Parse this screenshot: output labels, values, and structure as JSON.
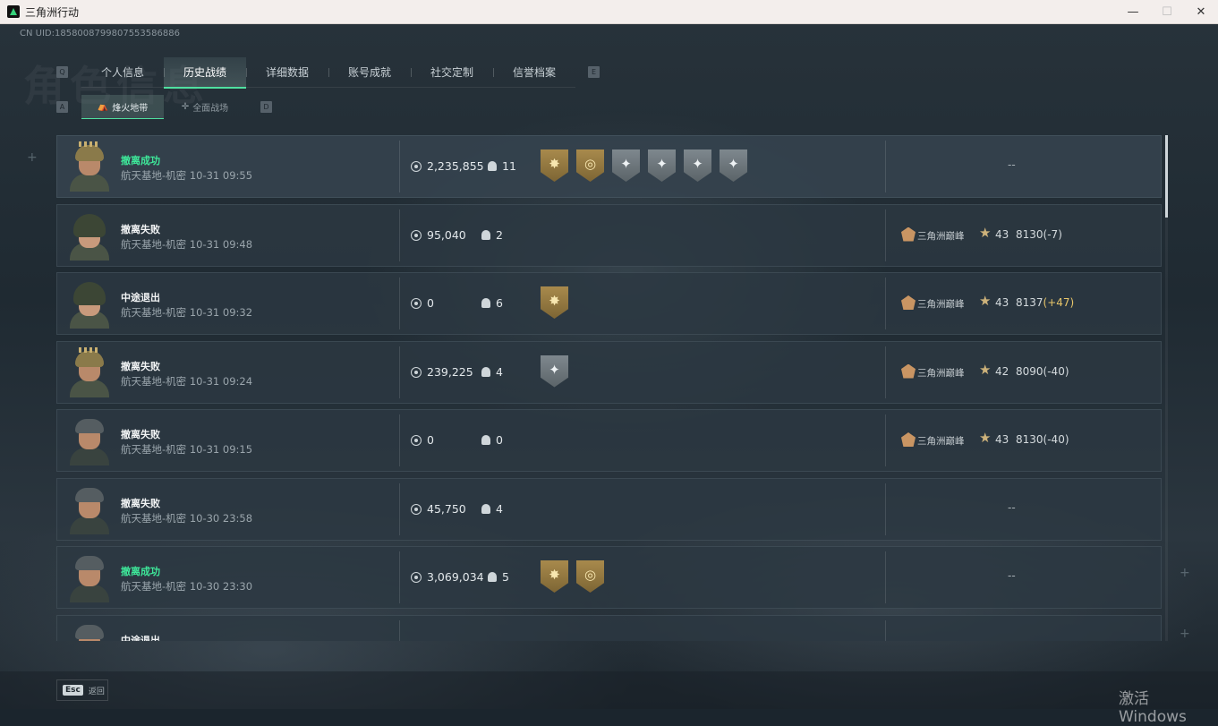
{
  "window": {
    "title": "三角洲行动",
    "controls": [
      "—",
      "☐",
      "✕"
    ]
  },
  "header": {
    "uid": "CN UID:1858008799807553586886",
    "watermark": "角色信息"
  },
  "tabs": {
    "left_key": "Q",
    "right_key": "E",
    "items": [
      "个人信息",
      "历史战绩",
      "详细数据",
      "账号成就",
      "社交定制",
      "信誉档案"
    ],
    "active_index": 1
  },
  "subtabs": {
    "left_key": "A",
    "right_key": "D",
    "items": [
      {
        "icon": "beacon-icon",
        "label": "烽火地带"
      },
      {
        "icon": "crosshair-icon",
        "label": "全面战场"
      }
    ]
  },
  "records": [
    {
      "status": "撤离成功",
      "success": true,
      "map": "航天基地-机密",
      "time": "10-31 09:55",
      "value": "2,235,855",
      "kills": "11",
      "badges": [
        "gold",
        "gold",
        "silver",
        "silver",
        "silver",
        "silver"
      ],
      "rank": null,
      "avatar": "crown"
    },
    {
      "status": "撤离失败",
      "success": false,
      "map": "航天基地-机密",
      "time": "10-31 09:48",
      "value": "95,040",
      "kills": "2",
      "badges": [],
      "rank": {
        "name": "三角洲巅峰",
        "level": "43",
        "points": "8130",
        "delta": "(-7)",
        "delta_positive": false
      },
      "avatar": "hood"
    },
    {
      "status": "中途退出",
      "success": false,
      "map": "航天基地-机密",
      "time": "10-31 09:32",
      "value": "0",
      "kills": "6",
      "badges": [
        "gold"
      ],
      "rank": {
        "name": "三角洲巅峰",
        "level": "43",
        "points": "8137",
        "delta": "(+47)",
        "delta_positive": true
      },
      "avatar": "hood"
    },
    {
      "status": "撤离失败",
      "success": false,
      "map": "航天基地-机密",
      "time": "10-31 09:24",
      "value": "239,225",
      "kills": "4",
      "badges": [
        "silver"
      ],
      "rank": {
        "name": "三角洲巅峰",
        "level": "42",
        "points": "8090",
        "delta": "(-40)",
        "delta_positive": false
      },
      "avatar": "crown"
    },
    {
      "status": "撤离失败",
      "success": false,
      "map": "航天基地-机密",
      "time": "10-31 09:15",
      "value": "0",
      "kills": "0",
      "badges": [],
      "rank": {
        "name": "三角洲巅峰",
        "level": "43",
        "points": "8130",
        "delta": "(-40)",
        "delta_positive": false
      },
      "avatar": "headset"
    },
    {
      "status": "撤离失败",
      "success": false,
      "map": "航天基地-机密",
      "time": "10-30 23:58",
      "value": "45,750",
      "kills": "4",
      "badges": [],
      "rank": null,
      "avatar": "headset"
    },
    {
      "status": "撤离成功",
      "success": true,
      "map": "航天基地-机密",
      "time": "10-30 23:30",
      "value": "3,069,034",
      "kills": "5",
      "badges": [
        "gold",
        "gold"
      ],
      "rank": null,
      "avatar": "headset"
    },
    {
      "status": "中途退出",
      "success": false,
      "map": "",
      "time": "",
      "value": "",
      "kills": "",
      "badges": [],
      "rank": null,
      "avatar": "headset"
    }
  ],
  "empty_rank": "--",
  "footer": {
    "esc_key": "Esc",
    "esc_label": "返回",
    "activation_notice": "激活 Windows"
  }
}
